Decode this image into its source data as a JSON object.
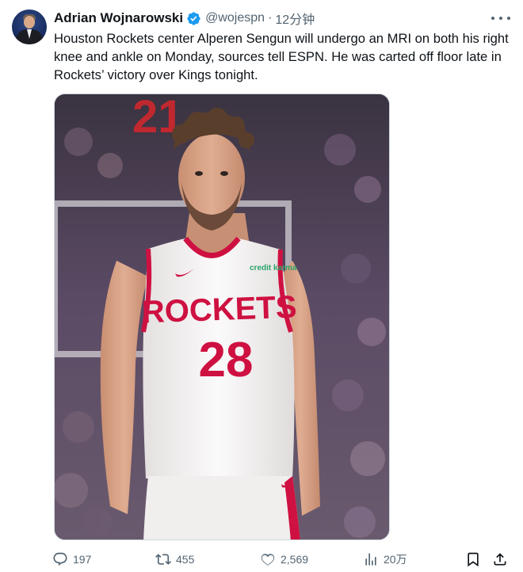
{
  "tweet": {
    "author_name": "Adrian Wojnarowski",
    "handle": "@wojespn",
    "separator": "·",
    "time": "12分钟",
    "text": "Houston Rockets center Alperen Sengun will undergo an MRI on both his right knee and ankle on Monday, sources tell ESPN. He was carted off floor late in Rockets’ victory over Kings tonight."
  },
  "media": {
    "jersey_wordmark": "ROCKETS",
    "jersey_number": "28",
    "sponsor_patch": "credit karma",
    "scoreboard_digits": "21",
    "colors": {
      "jersey": "#f6f4f4",
      "trim": "#ce1141",
      "crowd_purple": "#5e4a6b",
      "skin": "#d7a286"
    }
  },
  "actions": {
    "replies": "197",
    "reposts": "455",
    "likes": "2,569",
    "views": "20万"
  },
  "icons": [
    "verified-badge-icon",
    "more-dots-icon",
    "reply-icon",
    "repost-icon",
    "like-icon",
    "views-icon",
    "bookmark-icon",
    "share-icon"
  ],
  "colors": {
    "text_primary": "#0f1419",
    "text_secondary": "#536471",
    "verified_blue": "#1d9bf0"
  }
}
